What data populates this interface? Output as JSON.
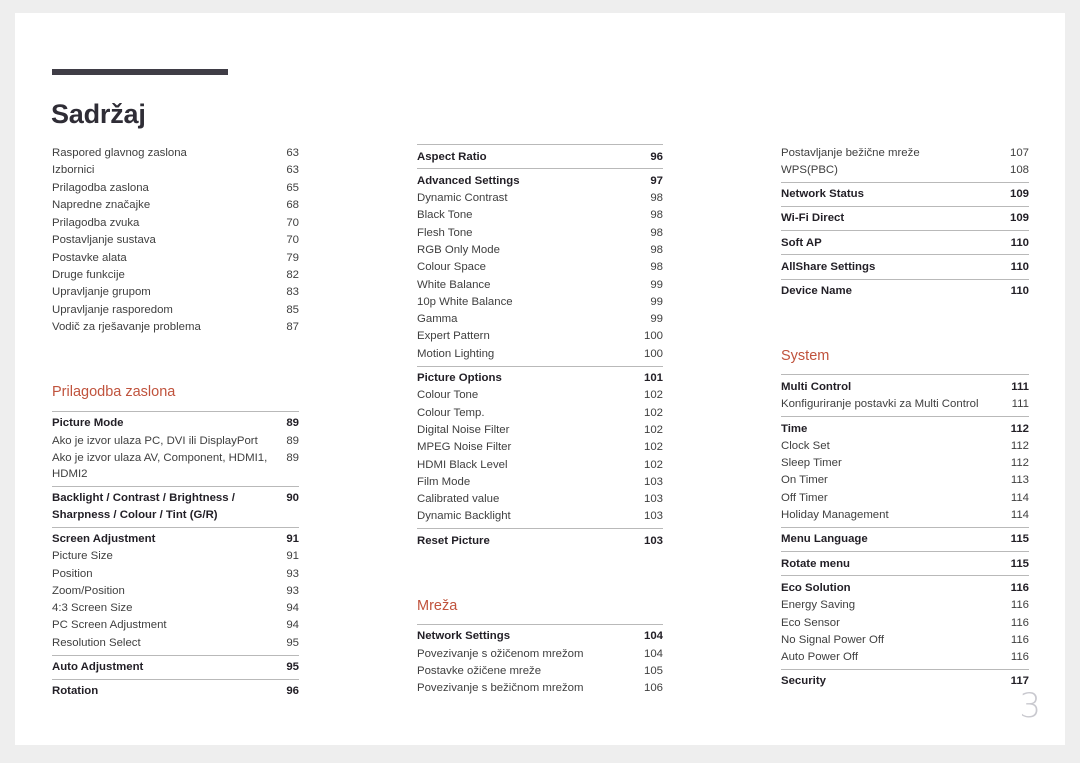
{
  "document": {
    "title": "Sadržaj",
    "folio": "3",
    "accent_color": "#c0533d",
    "title_rule_color": "#3f3d46",
    "rule_color": "#b9b9b9"
  },
  "columns": [
    {
      "name": "column-1",
      "blocks": [
        {
          "section_title": null,
          "style": "plain",
          "groups": [
            {
              "rule": false,
              "rows": [
                {
                  "label": "Raspored glavnog zaslona",
                  "page": "63",
                  "bold": false
                },
                {
                  "label": "Izbornici",
                  "page": "63",
                  "bold": false
                },
                {
                  "label": "Prilagodba zaslona",
                  "page": "65",
                  "bold": false
                },
                {
                  "label": "Napredne značajke",
                  "page": "68",
                  "bold": false
                },
                {
                  "label": "Prilagodba zvuka",
                  "page": "70",
                  "bold": false
                },
                {
                  "label": "Postavljanje sustava",
                  "page": "70",
                  "bold": false
                },
                {
                  "label": "Postavke alata",
                  "page": "79",
                  "bold": false
                },
                {
                  "label": "Druge funkcije",
                  "page": "82",
                  "bold": false
                },
                {
                  "label": "Upravljanje grupom",
                  "page": "83",
                  "bold": false
                },
                {
                  "label": "Upravljanje rasporedom",
                  "page": "85",
                  "bold": false
                },
                {
                  "label": "Vodič za rješavanje problema",
                  "page": "87",
                  "bold": false
                }
              ]
            }
          ]
        },
        {
          "section_title": "Prilagodba zaslona",
          "style": "ruled",
          "groups": [
            {
              "rule": true,
              "rows": [
                {
                  "label": "Picture Mode",
                  "page": "89",
                  "bold": true
                },
                {
                  "label": "Ako je izvor ulaza PC, DVI ili DisplayPort",
                  "page": "89",
                  "bold": false
                },
                {
                  "label": "Ako je izvor ulaza AV, Component, HDMI1, HDMI2",
                  "page": "89",
                  "bold": false,
                  "wrap": true
                }
              ]
            },
            {
              "rule": true,
              "rows": [
                {
                  "label": "Backlight / Contrast / Brightness / Sharpness / Colour / Tint (G/R)",
                  "page": "90",
                  "bold": true,
                  "wrap": true
                }
              ]
            },
            {
              "rule": true,
              "rows": [
                {
                  "label": "Screen Adjustment",
                  "page": "91",
                  "bold": true
                },
                {
                  "label": "Picture Size",
                  "page": "91",
                  "bold": false
                },
                {
                  "label": "Position",
                  "page": "93",
                  "bold": false
                },
                {
                  "label": "Zoom/Position",
                  "page": "93",
                  "bold": false
                },
                {
                  "label": "4:3 Screen Size",
                  "page": "94",
                  "bold": false
                },
                {
                  "label": "PC Screen Adjustment",
                  "page": "94",
                  "bold": false
                },
                {
                  "label": "Resolution Select",
                  "page": "95",
                  "bold": false
                }
              ]
            },
            {
              "rule": true,
              "rows": [
                {
                  "label": "Auto Adjustment",
                  "page": "95",
                  "bold": true
                }
              ]
            },
            {
              "rule": true,
              "rows": [
                {
                  "label": "Rotation",
                  "page": "96",
                  "bold": true
                }
              ]
            }
          ]
        }
      ]
    },
    {
      "name": "column-2",
      "blocks": [
        {
          "section_title": null,
          "style": "ruled",
          "groups": [
            {
              "rule": true,
              "rows": [
                {
                  "label": "Aspect Ratio",
                  "page": "96",
                  "bold": true
                }
              ]
            },
            {
              "rule": true,
              "rows": [
                {
                  "label": "Advanced Settings",
                  "page": "97",
                  "bold": true
                },
                {
                  "label": "Dynamic Contrast",
                  "page": "98",
                  "bold": false
                },
                {
                  "label": "Black Tone",
                  "page": "98",
                  "bold": false
                },
                {
                  "label": "Flesh Tone",
                  "page": "98",
                  "bold": false
                },
                {
                  "label": "RGB Only Mode",
                  "page": "98",
                  "bold": false
                },
                {
                  "label": "Colour Space",
                  "page": "98",
                  "bold": false
                },
                {
                  "label": "White Balance",
                  "page": "99",
                  "bold": false
                },
                {
                  "label": "10p White Balance",
                  "page": "99",
                  "bold": false
                },
                {
                  "label": "Gamma",
                  "page": "99",
                  "bold": false
                },
                {
                  "label": "Expert Pattern",
                  "page": "100",
                  "bold": false
                },
                {
                  "label": "Motion Lighting",
                  "page": "100",
                  "bold": false
                }
              ]
            },
            {
              "rule": true,
              "rows": [
                {
                  "label": "Picture Options",
                  "page": "101",
                  "bold": true
                },
                {
                  "label": "Colour Tone",
                  "page": "102",
                  "bold": false
                },
                {
                  "label": "Colour Temp.",
                  "page": "102",
                  "bold": false
                },
                {
                  "label": "Digital Noise Filter",
                  "page": "102",
                  "bold": false
                },
                {
                  "label": "MPEG Noise Filter",
                  "page": "102",
                  "bold": false
                },
                {
                  "label": "HDMI Black Level",
                  "page": "102",
                  "bold": false
                },
                {
                  "label": "Film Mode",
                  "page": "103",
                  "bold": false
                },
                {
                  "label": "Calibrated value",
                  "page": "103",
                  "bold": false
                },
                {
                  "label": "Dynamic Backlight",
                  "page": "103",
                  "bold": false
                }
              ]
            },
            {
              "rule": true,
              "rows": [
                {
                  "label": "Reset Picture",
                  "page": "103",
                  "bold": true
                }
              ]
            }
          ]
        },
        {
          "section_title": "Mreža",
          "style": "ruled",
          "groups": [
            {
              "rule": true,
              "rows": [
                {
                  "label": "Network Settings",
                  "page": "104",
                  "bold": true
                },
                {
                  "label": "Povezivanje s ožičenom mrežom",
                  "page": "104",
                  "bold": false
                },
                {
                  "label": "Postavke ožičene mreže",
                  "page": "105",
                  "bold": false
                },
                {
                  "label": "Povezivanje s bežičnom mrežom",
                  "page": "106",
                  "bold": false
                }
              ]
            }
          ]
        }
      ]
    },
    {
      "name": "column-3",
      "blocks": [
        {
          "section_title": null,
          "style": "ruled",
          "groups": [
            {
              "rule": false,
              "rows": [
                {
                  "label": "Postavljanje bežične mreže",
                  "page": "107",
                  "bold": false
                },
                {
                  "label": "WPS(PBC)",
                  "page": "108",
                  "bold": false
                }
              ]
            },
            {
              "rule": true,
              "rows": [
                {
                  "label": "Network Status",
                  "page": "109",
                  "bold": true
                }
              ]
            },
            {
              "rule": true,
              "rows": [
                {
                  "label": "Wi-Fi Direct",
                  "page": "109",
                  "bold": true
                }
              ]
            },
            {
              "rule": true,
              "rows": [
                {
                  "label": "Soft AP",
                  "page": "110",
                  "bold": true
                }
              ]
            },
            {
              "rule": true,
              "rows": [
                {
                  "label": "AllShare Settings",
                  "page": "110",
                  "bold": true
                }
              ]
            },
            {
              "rule": true,
              "rows": [
                {
                  "label": "Device Name",
                  "page": "110",
                  "bold": true
                }
              ]
            }
          ]
        },
        {
          "section_title": "System",
          "style": "ruled",
          "groups": [
            {
              "rule": true,
              "rows": [
                {
                  "label": "Multi Control",
                  "page": "111",
                  "bold": true
                },
                {
                  "label": "Konfiguriranje postavki za Multi Control",
                  "page": "111",
                  "bold": false
                }
              ]
            },
            {
              "rule": true,
              "rows": [
                {
                  "label": "Time",
                  "page": "112",
                  "bold": true
                },
                {
                  "label": "Clock Set",
                  "page": "112",
                  "bold": false
                },
                {
                  "label": "Sleep Timer",
                  "page": "112",
                  "bold": false
                },
                {
                  "label": "On Timer",
                  "page": "113",
                  "bold": false
                },
                {
                  "label": "Off Timer",
                  "page": "114",
                  "bold": false
                },
                {
                  "label": "Holiday Management",
                  "page": "114",
                  "bold": false
                }
              ]
            },
            {
              "rule": true,
              "rows": [
                {
                  "label": "Menu Language",
                  "page": "115",
                  "bold": true
                }
              ]
            },
            {
              "rule": true,
              "rows": [
                {
                  "label": "Rotate menu",
                  "page": "115",
                  "bold": true
                }
              ]
            },
            {
              "rule": true,
              "rows": [
                {
                  "label": "Eco Solution",
                  "page": "116",
                  "bold": true
                },
                {
                  "label": "Energy Saving",
                  "page": "116",
                  "bold": false
                },
                {
                  "label": "Eco Sensor",
                  "page": "116",
                  "bold": false
                },
                {
                  "label": "No Signal Power Off",
                  "page": "116",
                  "bold": false
                },
                {
                  "label": "Auto Power Off",
                  "page": "116",
                  "bold": false
                }
              ]
            },
            {
              "rule": true,
              "rows": [
                {
                  "label": "Security",
                  "page": "117",
                  "bold": true
                }
              ]
            }
          ]
        }
      ]
    }
  ]
}
